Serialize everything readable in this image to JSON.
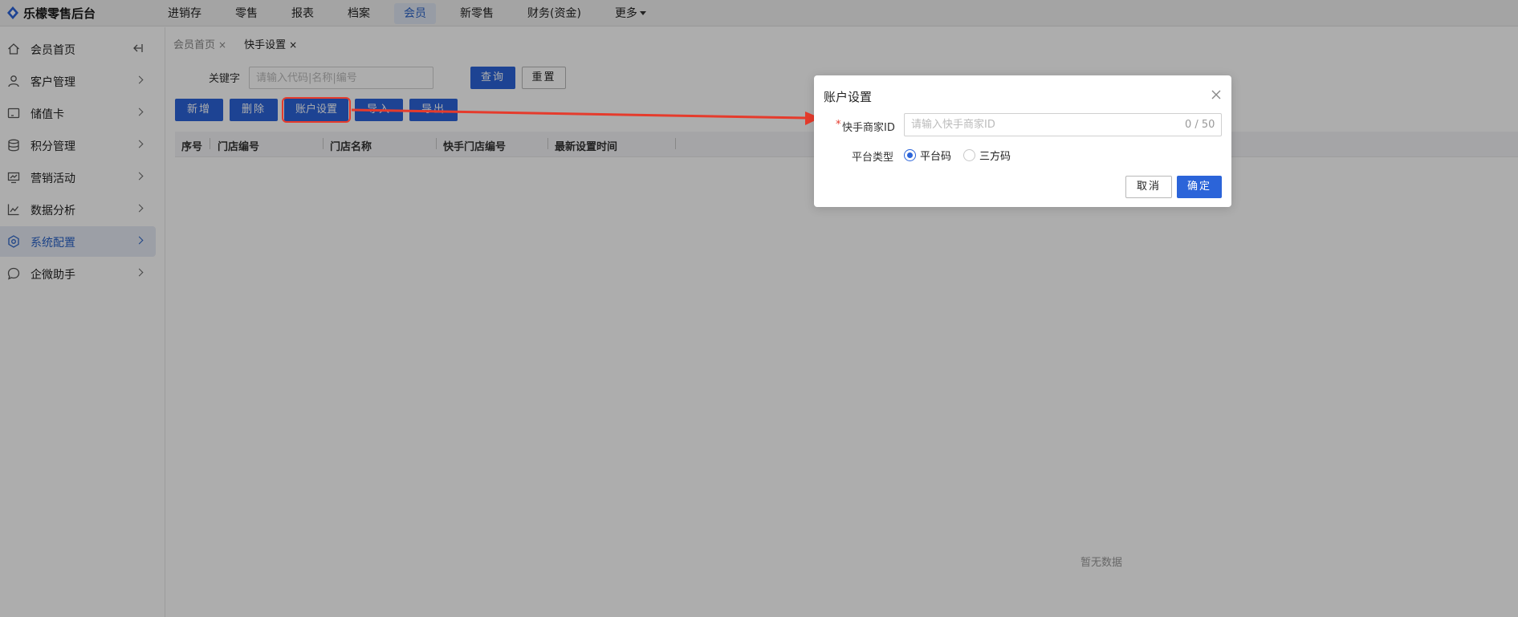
{
  "app": {
    "title": "乐檬零售后台"
  },
  "topnav": [
    {
      "label": "进销存",
      "active": false
    },
    {
      "label": "零售",
      "active": false
    },
    {
      "label": "报表",
      "active": false
    },
    {
      "label": "档案",
      "active": false
    },
    {
      "label": "会员",
      "active": true
    },
    {
      "label": "新零售",
      "active": false
    },
    {
      "label": "财务(资金)",
      "active": false
    },
    {
      "label": "更多",
      "active": false
    }
  ],
  "sidebar": {
    "items": [
      {
        "label": "会员首页",
        "icon": "home-icon",
        "active": false
      },
      {
        "label": "客户管理",
        "icon": "user-icon",
        "active": false
      },
      {
        "label": "储值卡",
        "icon": "card-icon",
        "active": false
      },
      {
        "label": "积分管理",
        "icon": "database-icon",
        "active": false
      },
      {
        "label": "营销活动",
        "icon": "monitor-icon",
        "active": false
      },
      {
        "label": "数据分析",
        "icon": "line-chart-icon",
        "active": false
      },
      {
        "label": "系统配置",
        "icon": "gear-icon",
        "active": true
      },
      {
        "label": "企微助手",
        "icon": "chat-icon",
        "active": false
      }
    ]
  },
  "tabs": [
    {
      "label": "会员首页",
      "close": "×",
      "active": false
    },
    {
      "label": "快手设置",
      "close": "×",
      "active": true
    }
  ],
  "search": {
    "keyword_label": "关键字",
    "placeholder": "请输入代码|名称|编号",
    "value": "",
    "query_button": "查询",
    "reset_button": "重置"
  },
  "toolbar": {
    "add": "新增",
    "delete": "删除",
    "account_settings": "账户设置",
    "import": "导入",
    "export": "导出"
  },
  "table": {
    "columns": [
      "序号",
      "门店编号",
      "门店名称",
      "快手门店编号",
      "最新设置时间"
    ],
    "rows": [],
    "empty_text": "暂无数据"
  },
  "dialog": {
    "title": "账户设置",
    "merchant_id_required_mark": "*",
    "merchant_id_label": "快手商家ID",
    "merchant_id_placeholder": "请输入快手商家ID",
    "merchant_id_value": "",
    "merchant_id_count": "0 / 50",
    "platform_type_label": "平台类型",
    "platform_options": [
      {
        "label": "平台码",
        "selected": true
      },
      {
        "label": "三方码",
        "selected": false
      }
    ],
    "cancel_button": "取消",
    "confirm_button": "确定"
  },
  "colors": {
    "primary": "#2b64d9",
    "annotation_red": "#e53b2c",
    "active_nav_bg": "#dfe6f3"
  }
}
